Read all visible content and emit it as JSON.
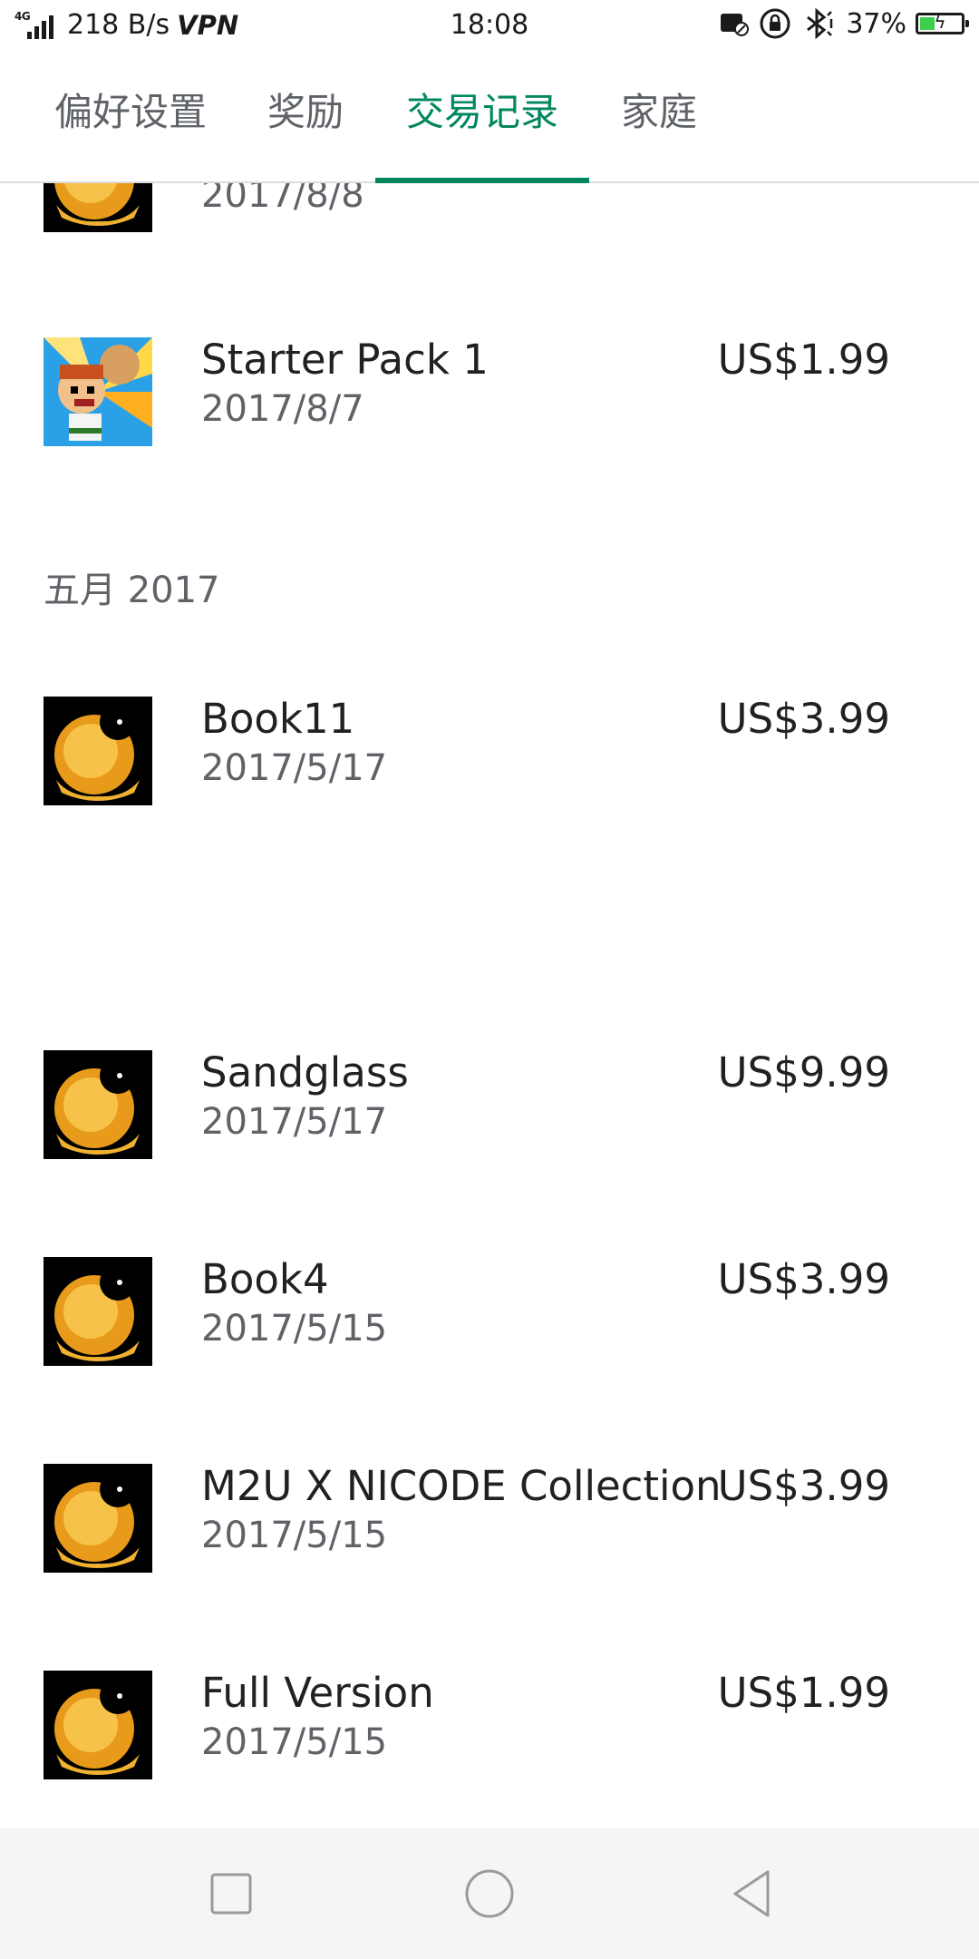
{
  "status_bar": {
    "network": "4G",
    "speed": "218 B/s",
    "vpn": "VPN",
    "time": "18:08",
    "battery": "37%",
    "battery_level": 0.37,
    "icons": [
      "signal-icon",
      "screenshot-icon",
      "rotation-lock-icon",
      "bluetooth-icon",
      "battery-icon"
    ]
  },
  "tabs": [
    {
      "label": "偏好设置",
      "active": false
    },
    {
      "label": "奖励",
      "active": false
    },
    {
      "label": "交易记录",
      "active": true
    },
    {
      "label": "家庭",
      "active": false
    }
  ],
  "accent_color": "#01875f",
  "items": [
    {
      "title": "",
      "date": "2017/8/8",
      "price": "",
      "icon": "deemo-icon"
    },
    {
      "title": "Starter Pack 1",
      "date": "2017/8/7",
      "price": "US$1.99",
      "icon": "dan-the-man-icon"
    }
  ],
  "section": {
    "label": "五月 2017"
  },
  "may_items": [
    {
      "title": "Book11",
      "date": "2017/5/17",
      "price": "US$3.99",
      "icon": "deemo-icon"
    },
    {
      "title": "Sandglass",
      "date": "2017/5/17",
      "price": "US$9.99",
      "icon": "deemo-icon"
    },
    {
      "title": "Book4",
      "date": "2017/5/15",
      "price": "US$3.99",
      "icon": "deemo-icon"
    },
    {
      "title": "M2U X NICODE Collection",
      "date": "2017/5/15",
      "price": "US$3.99",
      "icon": "deemo-icon"
    },
    {
      "title": "Full Version",
      "date": "2017/5/15",
      "price": "US$1.99",
      "icon": "deemo-icon"
    }
  ],
  "nav": {
    "buttons": [
      "recents-button",
      "home-button",
      "back-button"
    ]
  }
}
